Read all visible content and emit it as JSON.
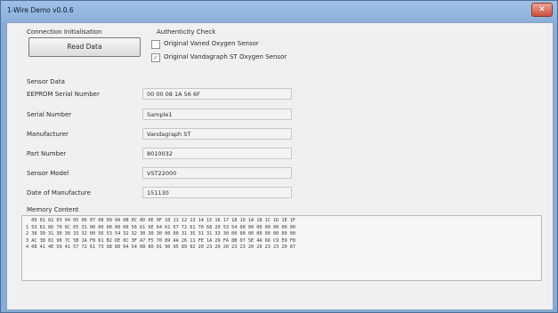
{
  "window": {
    "title": "1-Wire Demo v0.0.6",
    "close_glyph": "✕"
  },
  "connection": {
    "label": "Connection Initialisation",
    "read_button": "Read Data"
  },
  "authenticity": {
    "label": "Authenticity Check",
    "options": [
      {
        "label": "Original Vaned Oxygen Sensor",
        "checked": false
      },
      {
        "label": "Original Vandagraph ST Oxygen Sensor",
        "checked": true,
        "check_glyph": "✓"
      }
    ]
  },
  "sensor": {
    "section_label": "Sensor Data",
    "fields": [
      {
        "label": "EEPROM Serial Number",
        "value": "00 00 08 1A 56 6F"
      },
      {
        "label": "Serial Number",
        "value": "Sample1"
      },
      {
        "label": "Manufacturer",
        "value": "Vandagraph ST"
      },
      {
        "label": "Part Number",
        "value": "8010032"
      },
      {
        "label": "Sensor Model",
        "value": "VST22000"
      },
      {
        "label": "Date of Manufacture",
        "value": "151130"
      }
    ]
  },
  "memory": {
    "label": "Memory Content",
    "lines": [
      "  00 01 02 03 04 05 06 07 08 09 0A 0B 0C 0D 0E 0F 10 11 12 13 14 15 16 17 18 19 1A 1B 1C 1D 1E 1F",
      "1 53 61 6D 70 6C 65 31 00 00 00 00 00 56 61 6E 64 61 67 72 61 70 68 20 53 54 00 00 00 00 00 00 00",
      "2 38 30 31 30 30 33 32 00 56 53 54 32 32 30 30 30 00 00 31 35 31 31 33 30 00 00 00 00 00 00 00 00",
      "3 AC 38 01 90 7C 5B 1A F8 61 B2 DE 0C 3F A7 F5 70 89 AA 26 11 FE 1A 29 FA 8B 07 5E 4A 66 C9 E9 F8",
      "4 08 41 4E 59 41 57 72 61 73 98 80 04 54 08 80 01 90 95 89 92 20 23 20 20 23 23 20 20 23 23 20 87"
    ]
  }
}
